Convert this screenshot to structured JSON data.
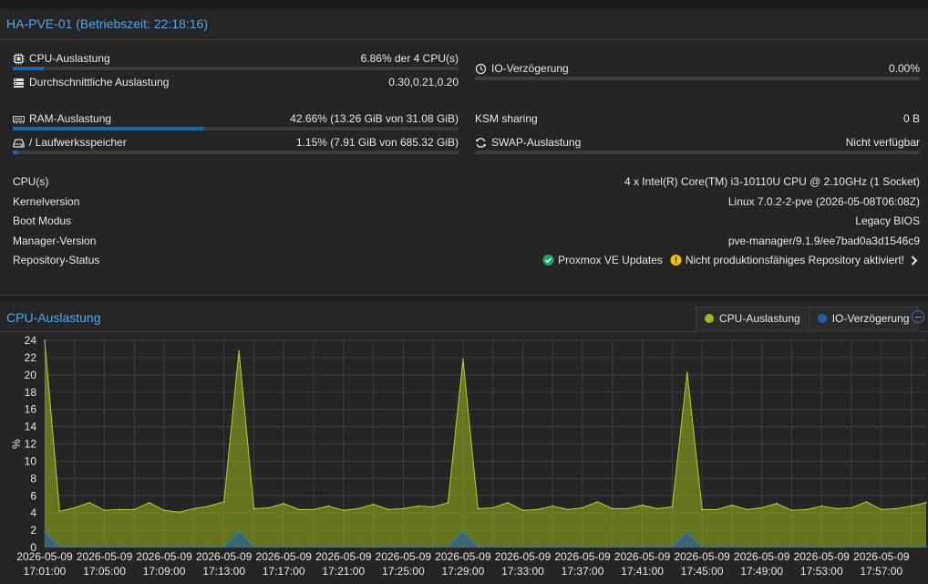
{
  "node_panel": {
    "title": "HA-PVE-01 (Betriebszeit: 22:18:16)",
    "cpu": {
      "label": "CPU-Auslastung",
      "value": "6.86% der 4 CPU(s)",
      "fraction": 0.0686
    },
    "load": {
      "label": "Durchschnittliche Auslastung",
      "value": "0.30,0.21,0.20"
    },
    "io_delay": {
      "label": "IO-Verzögerung",
      "value": "0.00%",
      "fraction": 0
    },
    "ram": {
      "label": "RAM-Auslastung",
      "value": "42.66% (13.26 GiB von 31.08 GiB)",
      "fraction": 0.4266
    },
    "ksm": {
      "label": "KSM sharing",
      "value": "0 B"
    },
    "disk": {
      "label": "/ Laufwerksspeicher",
      "value": "1.15% (7.91 GiB von 685.32 GiB)",
      "fraction": 0.0115
    },
    "swap": {
      "label": "SWAP-Auslastung",
      "value": "Nicht verfügbar",
      "fraction": 0
    },
    "info": [
      {
        "label": "CPU(s)",
        "value": "4 x Intel(R) Core(TM) i3-10110U CPU @ 2.10GHz (1 Socket)"
      },
      {
        "label": "Kernelversion",
        "value": "Linux 7.0.2-2-pve (2026-05-08T06:08Z)"
      },
      {
        "label": "Boot Modus",
        "value": "Legacy BIOS"
      },
      {
        "label": "Manager-Version",
        "value": "pve-manager/9.1.9/ee7bad0a3d1546c9"
      }
    ],
    "repo": {
      "label": "Repository-Status",
      "ok_text": "Proxmox VE Updates",
      "warn_text": "Nicht produktionsfähiges Repository aktiviert!"
    }
  },
  "cpu_chart_panel": {
    "title": "CPU-Auslastung",
    "legend": [
      {
        "name": "CPU-Auslastung",
        "color": "#9ab61a"
      },
      {
        "name": "IO-Verzögerung",
        "color": "#1c5ea8"
      }
    ]
  },
  "chart_data": {
    "type": "area",
    "ylabel": "%",
    "ylim": [
      0,
      24
    ],
    "yticks": [
      0,
      2,
      4,
      6,
      8,
      10,
      12,
      14,
      16,
      18,
      20,
      22,
      24
    ],
    "grid": true,
    "legend": "top-right",
    "x_labels": [
      [
        "2026-05-09",
        "17:01:00"
      ],
      [
        "2026-05-09",
        "17:05:00"
      ],
      [
        "2026-05-09",
        "17:09:00"
      ],
      [
        "2026-05-09",
        "17:13:00"
      ],
      [
        "2026-05-09",
        "17:17:00"
      ],
      [
        "2026-05-09",
        "17:21:00"
      ],
      [
        "2026-05-09",
        "17:25:00"
      ],
      [
        "2026-05-09",
        "17:29:00"
      ],
      [
        "2026-05-09",
        "17:33:00"
      ],
      [
        "2026-05-09",
        "17:37:00"
      ],
      [
        "2026-05-09",
        "17:41:00"
      ],
      [
        "2026-05-09",
        "17:45:00"
      ],
      [
        "2026-05-09",
        "17:49:00"
      ],
      [
        "2026-05-09",
        "17:53:00"
      ],
      [
        "2026-05-09",
        "17:57:00"
      ]
    ],
    "x_minutes": [
      61,
      62,
      63,
      64,
      65,
      66,
      67,
      68,
      69,
      70,
      71,
      72,
      73,
      74,
      75,
      76,
      77,
      78,
      79,
      80,
      81,
      82,
      83,
      84,
      85,
      86,
      87,
      88,
      89,
      90,
      91,
      92,
      93,
      94,
      95,
      96,
      97,
      98,
      99,
      100,
      101,
      102,
      103,
      104,
      105,
      106,
      107,
      108,
      109,
      110,
      111,
      112,
      113,
      114,
      115,
      116,
      117,
      118,
      119,
      120
    ],
    "series": [
      {
        "name": "CPU-Auslastung",
        "color": "#9ab61a",
        "values": [
          24,
          4.2,
          4.6,
          5.2,
          4.3,
          4.4,
          4.4,
          5.2,
          4.3,
          4.1,
          4.5,
          4.8,
          5.3,
          22.8,
          4.5,
          4.6,
          5.1,
          4.4,
          4.4,
          4.8,
          4.3,
          4.5,
          5.0,
          4.4,
          4.5,
          4.8,
          4.7,
          5.2,
          21.8,
          4.5,
          4.6,
          5.2,
          4.3,
          4.4,
          4.8,
          4.4,
          4.6,
          5.3,
          4.5,
          4.5,
          4.9,
          4.5,
          4.7,
          20.3,
          4.4,
          4.4,
          4.9,
          4.4,
          4.6,
          5.1,
          4.3,
          4.4,
          4.8,
          4.5,
          4.6,
          5.3,
          4.4,
          4.5,
          4.8,
          5.2
        ]
      },
      {
        "name": "IO-Verzögerung",
        "color": "#1c5ea8",
        "values": [
          1.8,
          0.1,
          0.1,
          0.1,
          0.1,
          0.1,
          0.1,
          0.1,
          0.1,
          0.1,
          0.1,
          0.1,
          0.1,
          1.8,
          0.1,
          0.1,
          0.1,
          0.1,
          0.1,
          0.1,
          0.1,
          0.1,
          0.1,
          0.1,
          0.1,
          0.1,
          0.1,
          0.1,
          1.8,
          0.1,
          0.1,
          0.1,
          0.1,
          0.1,
          0.1,
          0.1,
          0.1,
          0.1,
          0.1,
          0.1,
          0.1,
          0.1,
          0.1,
          1.7,
          0.1,
          0.1,
          0.1,
          0.1,
          0.1,
          0.1,
          0.1,
          0.1,
          0.1,
          0.1,
          0.1,
          0.1,
          0.1,
          0.1,
          0.1,
          0.1
        ]
      }
    ]
  }
}
